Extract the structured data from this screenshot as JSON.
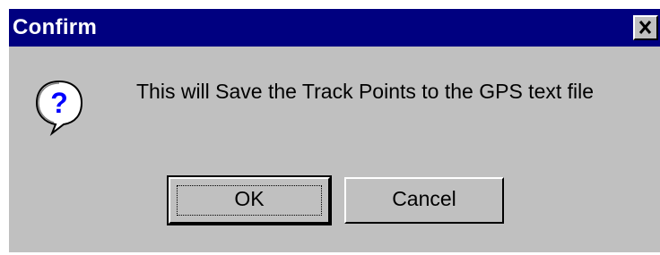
{
  "dialog": {
    "title": "Confirm",
    "close_icon": "close-x-icon",
    "icon": "question-balloon-icon",
    "icon_glyph": "?",
    "message": "This will Save the Track Points to the GPS text file",
    "buttons": {
      "ok_label": "OK",
      "cancel_label": "Cancel"
    }
  },
  "colors": {
    "titlebar": "#000080",
    "face": "#c0c0c0",
    "icon_glyph": "#0000ff"
  }
}
